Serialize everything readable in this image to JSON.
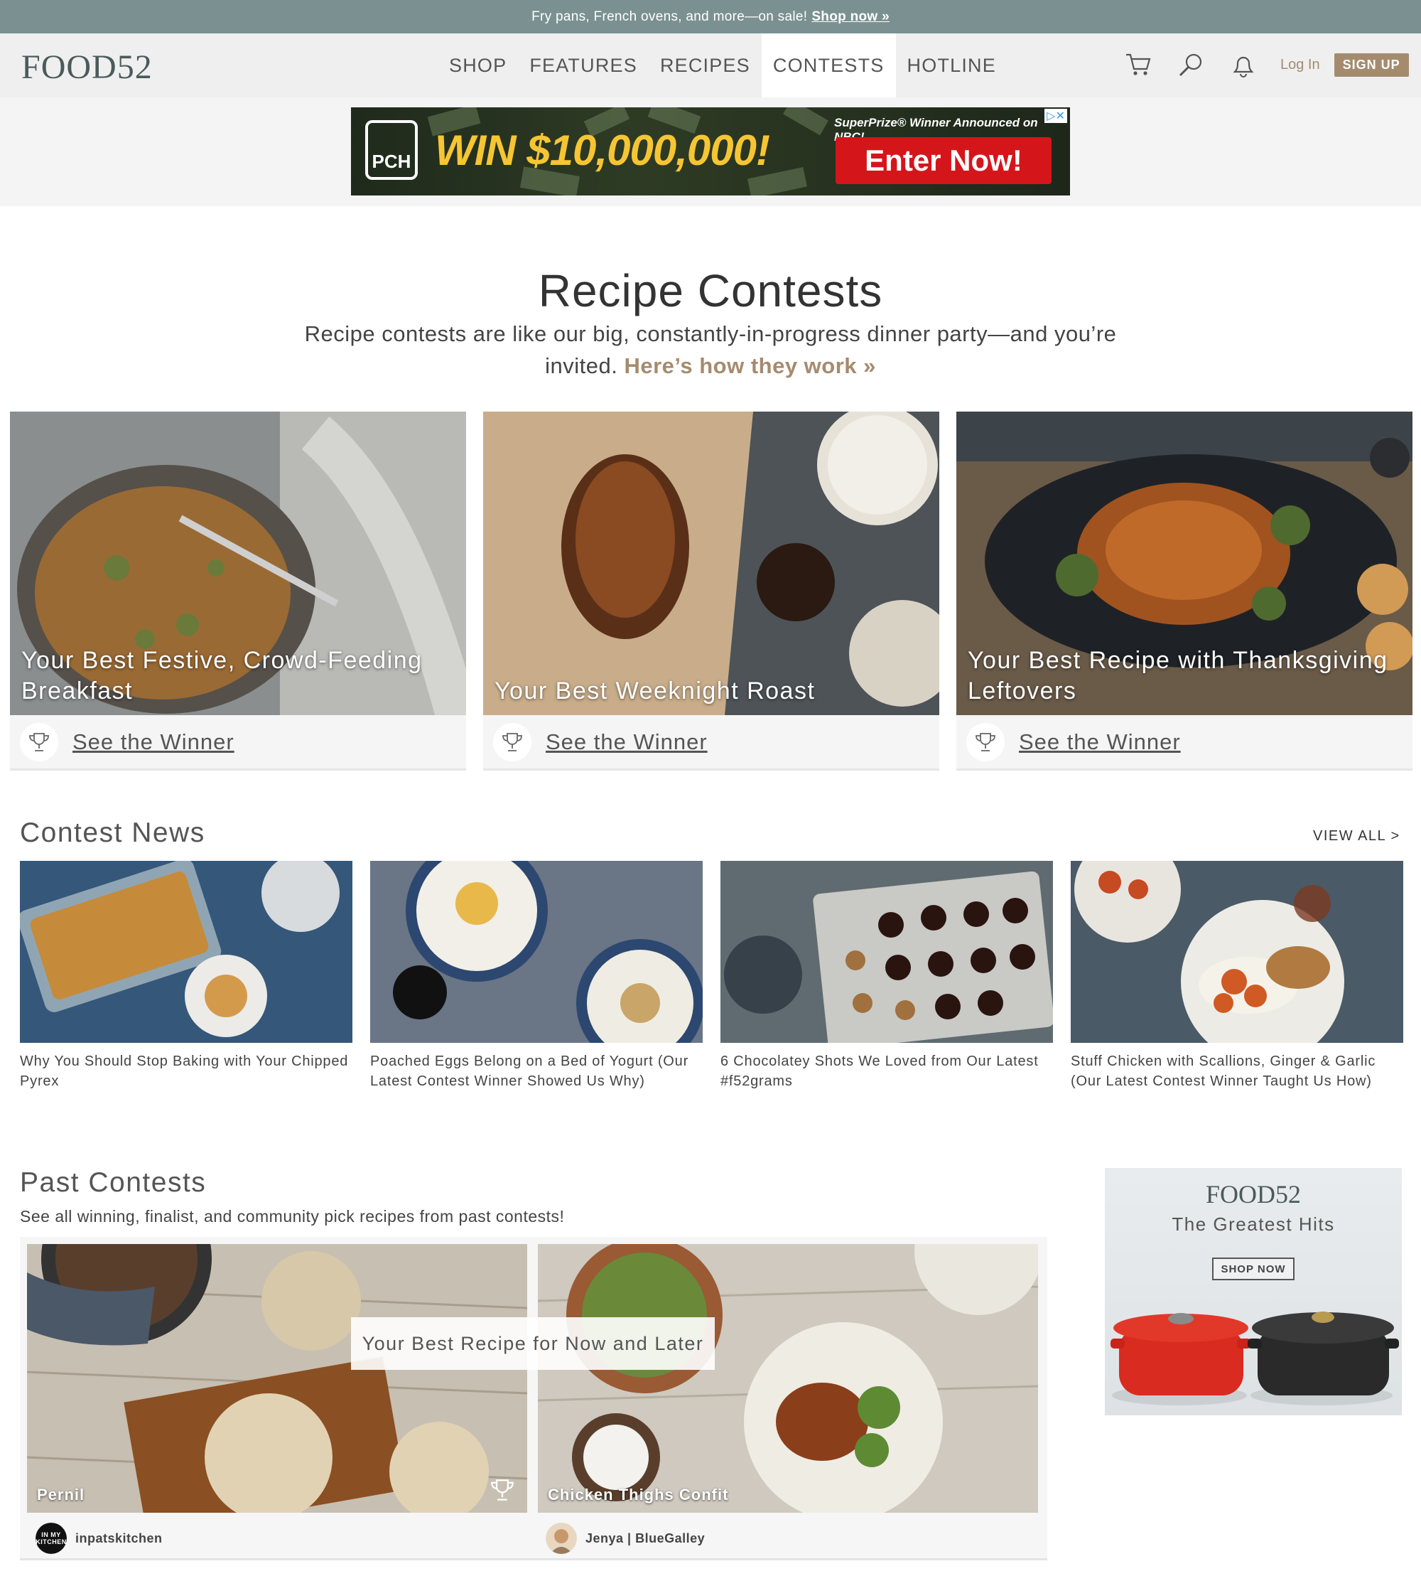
{
  "promo": {
    "text": "Fry pans, French ovens, and more—on sale!",
    "link": "Shop now »"
  },
  "header": {
    "logo": "FOOD52",
    "nav": [
      "SHOP",
      "FEATURES",
      "RECIPES",
      "CONTESTS",
      "HOTLINE"
    ],
    "active_nav": "CONTESTS",
    "icons": [
      "cart-icon",
      "search-icon",
      "bell-icon"
    ],
    "login": "Log In",
    "signup": "SIGN UP"
  },
  "ad": {
    "brand": "PCH",
    "headline": "WIN $10,000,000!",
    "tagline": "SuperPrize® Winner Announced on NBC!",
    "cta": "Enter Now!"
  },
  "hero": {
    "title": "Recipe Contests",
    "subtitle": "Recipe contests are like our big, constantly-in-progress dinner party—and you’re invited.",
    "link": "Here’s how they work »"
  },
  "contests": [
    {
      "title": "Your Best Festive, Crowd-Feeding Breakfast",
      "cta": "See the Winner"
    },
    {
      "title": "Your Best Weeknight Roast",
      "cta": "See the Winner"
    },
    {
      "title": "Your Best Recipe with Thanksgiving Leftovers",
      "cta": "See the Winner"
    }
  ],
  "news": {
    "title": "Contest News",
    "view_all": "VIEW ALL >",
    "items": [
      "Why You Should Stop Baking with Your Chipped Pyrex",
      "Poached Eggs Belong on a Bed of Yogurt (Our Latest Contest Winner Showed Us Why)",
      "6 Chocolatey Shots We Loved from Our Latest #f52grams",
      "Stuff Chicken with Scallions, Ginger & Garlic (Our Latest Contest Winner Taught Us How)"
    ]
  },
  "past": {
    "title": "Past Contests",
    "subtitle": "See all winning, finalist, and community pick recipes from past contests!",
    "contest_name": "Your Best Recipe for Now and Later",
    "recipes": [
      {
        "name": "Pernil",
        "author": "inpatskitchen",
        "avatar_text": "IN MY KITCHEN"
      },
      {
        "name": "Chicken Thighs Confit",
        "author": "Jenya | BlueGalley"
      }
    ]
  },
  "side_ad": {
    "logo": "FOOD52",
    "tagline": "The Greatest Hits",
    "cta": "SHOP NOW"
  },
  "colors": {
    "promo_bg": "#7b9191",
    "accent": "#a58b6e",
    "header_bg": "#efefef"
  }
}
